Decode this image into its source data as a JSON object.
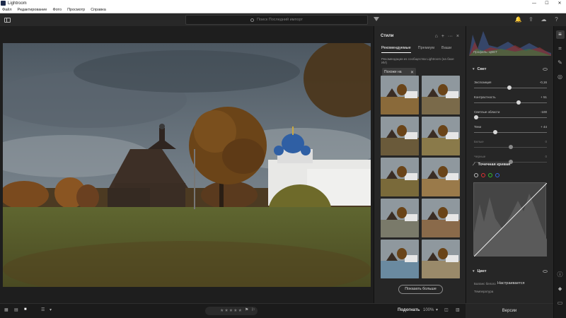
{
  "window": {
    "title": "Lightroom",
    "controls": [
      "—",
      "☐",
      "✕"
    ]
  },
  "menu": [
    "Файл",
    "Редактирование",
    "Фото",
    "Просмотр",
    "Справка"
  ],
  "search": {
    "placeholder": "Поиск Последний импорт"
  },
  "styles_panel": {
    "title": "Стили",
    "tabs": [
      "Рекомендуемые",
      "Премиум",
      "Ваши"
    ],
    "description": "Рекомендации из сообщества Lightroom (на базе ИИ)",
    "chip_label": "Похоже на",
    "show_more": "Показать больше"
  },
  "adjust_panel": {
    "histogram_label": "Профиль: ЦВЕТ",
    "light_section": "Свет",
    "sliders": [
      {
        "label": "Экспозиция",
        "value": "-0,16",
        "level": 0.48
      },
      {
        "label": "Контрастность",
        "value": "+ 51",
        "level": 0.62
      },
      {
        "label": "Светлые области",
        "value": "-100",
        "level": 0.0
      },
      {
        "label": "Тени",
        "value": "+ 44",
        "level": 0.28
      },
      {
        "label": "Белые",
        "value": "0",
        "level": 0.5
      },
      {
        "label": "Черные",
        "value": "0",
        "level": 0.5
      }
    ],
    "curve_section": "Точечная кривая",
    "color_section": "Цвет",
    "wb_label": "Баланс белого",
    "wb_value": "Настраивается",
    "temp_label": "Температура"
  },
  "bottom": {
    "stars": "★★★★★",
    "fit": "Подогнать",
    "zoom": "100%",
    "versions": "Версии"
  },
  "colors": {
    "panel": "#262626",
    "bg": "#1e1e1e",
    "accent": "#ffffff"
  }
}
